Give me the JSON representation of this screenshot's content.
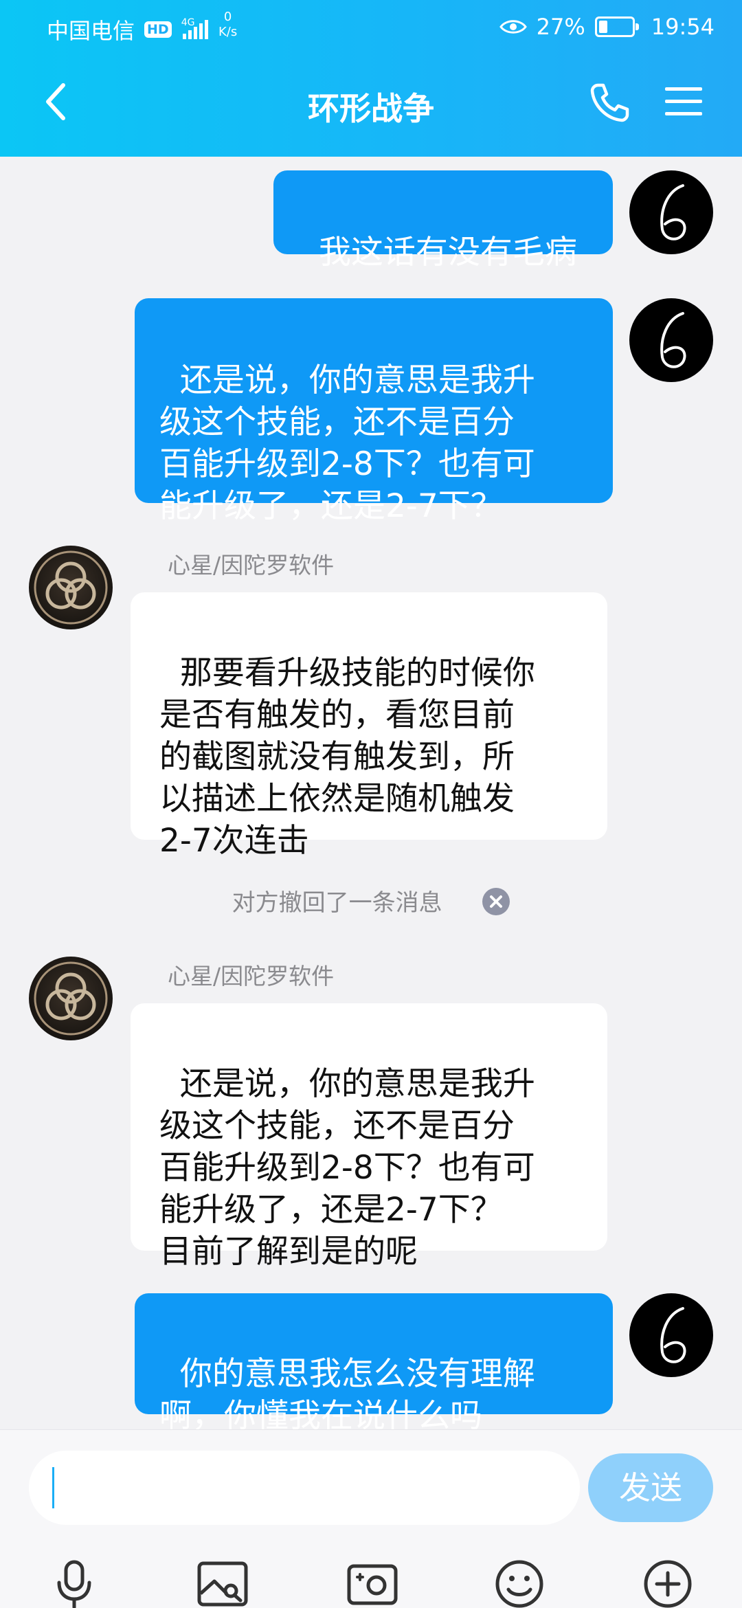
{
  "status_bar": {
    "carrier": "中国电信",
    "hd": "HD",
    "network": "4G",
    "net_speed_value": "0",
    "net_speed_unit": "K/s",
    "battery_percent": "27%",
    "battery_level": 0.27,
    "time": "19:54"
  },
  "header": {
    "title": "环形战争",
    "back_icon": "chevron-left-icon",
    "call_icon": "phone-icon",
    "menu_icon": "menu-icon"
  },
  "messages": [
    {
      "from": "me",
      "text": "我这话有没有毛病"
    },
    {
      "from": "me",
      "text": "还是说，你的意思是我升\n级这个技能，还不是百分\n百能升级到2-8下？也有可\n能升级了，还是2-7下？"
    },
    {
      "from": "them",
      "sender": "心星/因陀罗软件",
      "text": "那要看升级技能的时候你\n是否有触发的，看您目前\n的截图就没有触发到，所\n以描述上依然是随机触发\n2-7次连击"
    },
    {
      "from": "system",
      "text": "对方撤回了一条消息"
    },
    {
      "from": "them",
      "sender": "心星/因陀罗软件",
      "text": "还是说，你的意思是我升\n级这个技能，还不是百分\n百能升级到2-8下？也有可\n能升级了，还是2-7下？\n目前了解到是的呢"
    },
    {
      "from": "me",
      "text": "你的意思我怎么没有理解\n啊，你懂我在说什么吗"
    }
  ],
  "input": {
    "placeholder": "",
    "send_label": "发送"
  },
  "toolbar": {
    "icons": [
      "microphone-icon",
      "image-icon",
      "camera-icon",
      "emoji-icon",
      "plus-icon"
    ]
  },
  "colors": {
    "header_gradient_start": "#0bc6f5",
    "header_gradient_end": "#23aaf6",
    "my_bubble": "#0f99f6",
    "their_bubble": "#ffffff",
    "background": "#f2f2f4",
    "send_button": "#8fd0fb"
  }
}
